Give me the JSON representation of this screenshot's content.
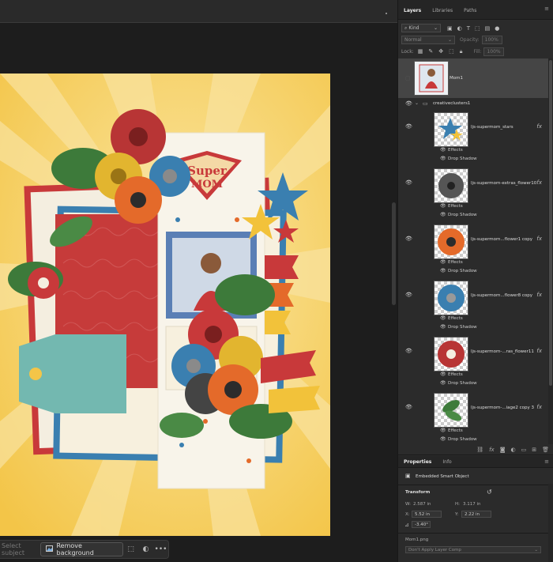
{
  "context_bar": {
    "select_subject": "Select subject",
    "remove_background": "Remove background"
  },
  "layers_panel": {
    "tabs": [
      "Layers",
      "Libraries",
      "Paths"
    ],
    "filter_kind": "Kind",
    "blend_mode": "Normal",
    "opacity_label": "Opacity:",
    "opacity_value": "100%",
    "lock_label": "Lock:",
    "fill_label": "Fill:",
    "fill_value": "100%",
    "layers": [
      {
        "name": "Mom1"
      },
      {
        "name": "creativeclusters1"
      },
      {
        "name": "ljs-supermom_stars",
        "effects": [
          "Effects",
          "Drop Shadow"
        ]
      },
      {
        "name": "ljs-supermom-extras_flower10",
        "effects": [
          "Effects",
          "Drop Shadow"
        ]
      },
      {
        "name": "ljs-supermom...flower1 copy",
        "effects": [
          "Effects",
          "Drop Shadow"
        ]
      },
      {
        "name": "ljs-supermom...flower8 copy",
        "effects": [
          "Effects",
          "Drop Shadow"
        ]
      },
      {
        "name": "ljs-supermom-...ras_flower11",
        "effects": [
          "Effects",
          "Drop Shadow"
        ]
      },
      {
        "name": "ljs-supermom-...iage2 copy 3",
        "effects": [
          "Effects",
          "Drop Shadow"
        ]
      }
    ]
  },
  "properties_panel": {
    "tabs": [
      "Properties",
      "Info"
    ],
    "object_type": "Embedded Smart Object",
    "section_title": "Transform",
    "w_label": "W:",
    "w_value": "2.587 in",
    "h_label": "H:",
    "h_value": "3.117 in",
    "x_label": "X:",
    "x_value": "5.52 in",
    "y_label": "Y:",
    "y_value": "2.22 in",
    "angle_value": "-3.40°",
    "file_name": "Mom1.png",
    "layer_comp": "Don't Apply Layer Comp"
  },
  "artwork": {
    "title_line1": "Super",
    "title_line2": "MOM"
  },
  "colors": {
    "accent_red": "#c8393a",
    "accent_yellow": "#f2c23a",
    "accent_blue": "#3a7fb0",
    "accent_orange": "#e46a2a",
    "accent_green": "#3d7a3a"
  }
}
